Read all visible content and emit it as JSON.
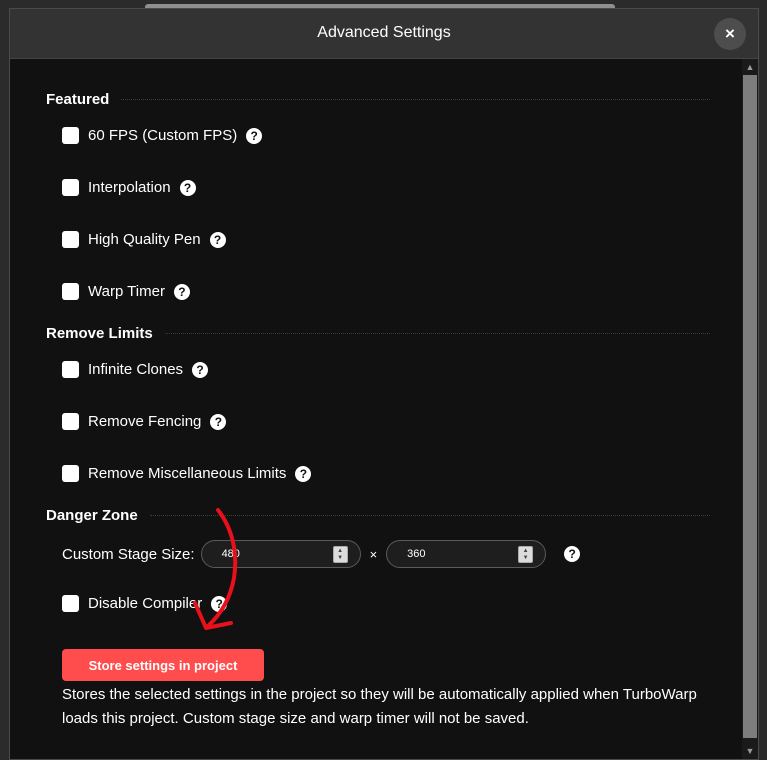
{
  "dialog": {
    "title": "Advanced Settings",
    "close_label": "×"
  },
  "sections": {
    "featured": {
      "title": "Featured",
      "options": [
        {
          "label": "60 FPS (Custom FPS)",
          "checked": false
        },
        {
          "label": "Interpolation",
          "checked": false
        },
        {
          "label": "High Quality Pen",
          "checked": false
        },
        {
          "label": "Warp Timer",
          "checked": false
        }
      ]
    },
    "remove_limits": {
      "title": "Remove Limits",
      "options": [
        {
          "label": "Infinite Clones",
          "checked": false
        },
        {
          "label": "Remove Fencing",
          "checked": false
        },
        {
          "label": "Remove Miscellaneous Limits",
          "checked": false
        }
      ]
    },
    "danger_zone": {
      "title": "Danger Zone",
      "stage_size_label": "Custom Stage Size:",
      "stage_width": "480",
      "stage_height": "360",
      "times_symbol": "×",
      "disable_compiler_label": "Disable Compiler",
      "disable_compiler_checked": false
    }
  },
  "help_icon_glyph": "?",
  "store": {
    "button_label": "Store settings in project",
    "description": "Stores the selected settings in the project so they will be automatically applied when TurboWarp loads this project. Custom stage size and warp timer will not be saved."
  },
  "colors": {
    "accent": "#ff4c4c",
    "background": "#111111",
    "header": "#333333",
    "annotation_arrow": "#e8101a"
  }
}
